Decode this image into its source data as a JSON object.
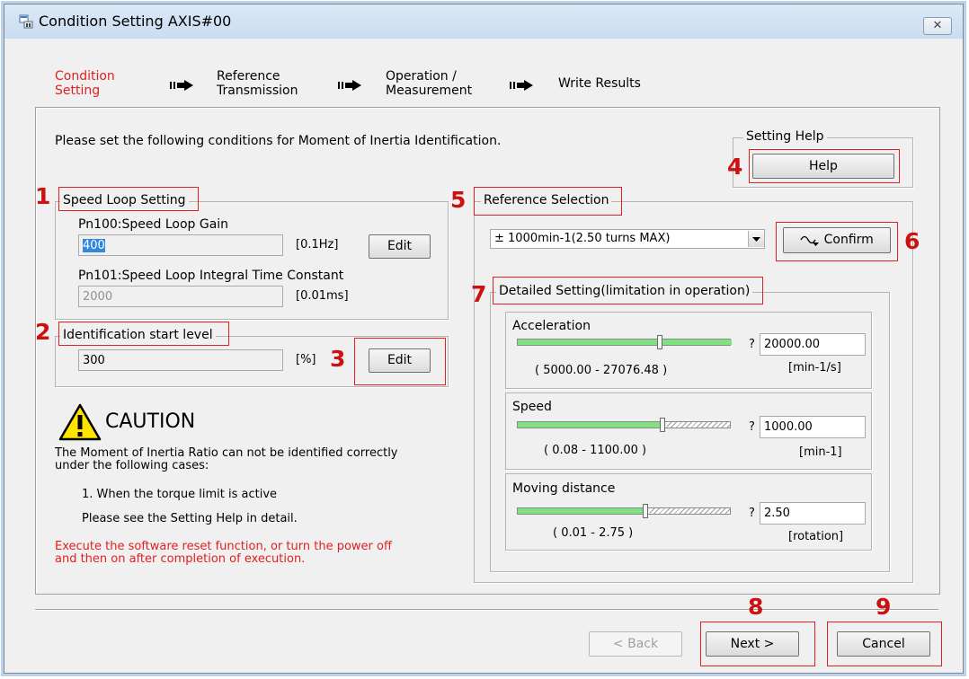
{
  "window": {
    "title": "Condition Setting AXIS#00",
    "close": "✕"
  },
  "steps": [
    {
      "line1": "Condition",
      "line2": "Setting"
    },
    {
      "line1": "Reference",
      "line2": "Transmission"
    },
    {
      "line1": "Operation /",
      "line2": "Measurement"
    },
    {
      "line1": "Write Results",
      "line2": ""
    }
  ],
  "intro": "Please set the following conditions for Moment of Inertia Identification.",
  "setting_help": {
    "legend": "Setting Help",
    "button": "Help"
  },
  "speed_loop": {
    "legend": "Speed Loop Setting",
    "gain_label": "Pn100:Speed Loop Gain",
    "gain_value": "400",
    "gain_unit": "[0.1Hz]",
    "edit": "Edit",
    "integral_label": "Pn101:Speed Loop Integral Time Constant",
    "integral_value": "2000",
    "integral_unit": "[0.01ms]"
  },
  "identification": {
    "legend": "Identification start level",
    "value": "300",
    "unit": "[%]",
    "edit": "Edit"
  },
  "caution": {
    "title": "CAUTION",
    "text1": "The Moment of Inertia Ratio can not be identified correctly",
    "text2": "under the following cases:",
    "item1": "1. When the torque limit is active",
    "item2": "Please see the Setting Help in detail.",
    "warn1": "Execute the software reset function, or turn the power off",
    "warn2": "and then on after completion of execution."
  },
  "reference": {
    "legend": "Reference Selection",
    "selected": "± 1000min-1(2.50 turns MAX)",
    "confirm": "Confirm"
  },
  "detailed": {
    "legend": "Detailed Setting(limitation in operation)",
    "acceleration": {
      "label": "Acceleration",
      "value": "20000.00",
      "range": "( 5000.00 - 27076.48 )",
      "unit": "[min-1/s]",
      "level": 0.67
    },
    "speed": {
      "label": "Speed",
      "value": "1000.00",
      "range": "( 0.08 - 1100.00 )",
      "unit": "[min-1]",
      "level": 0.68
    },
    "distance": {
      "label": "Moving distance",
      "value": "2.50",
      "range": "( 0.01 - 2.75 )",
      "unit": "[rotation]",
      "level": 0.6
    },
    "q": "?"
  },
  "callouts": [
    "1",
    "2",
    "3",
    "4",
    "5",
    "6",
    "7",
    "8",
    "9"
  ],
  "footer": {
    "back": "< Back",
    "next": "Next >",
    "cancel": "Cancel"
  },
  "colors": {
    "highlight": "#e02020",
    "slider": "#7fe17f"
  }
}
